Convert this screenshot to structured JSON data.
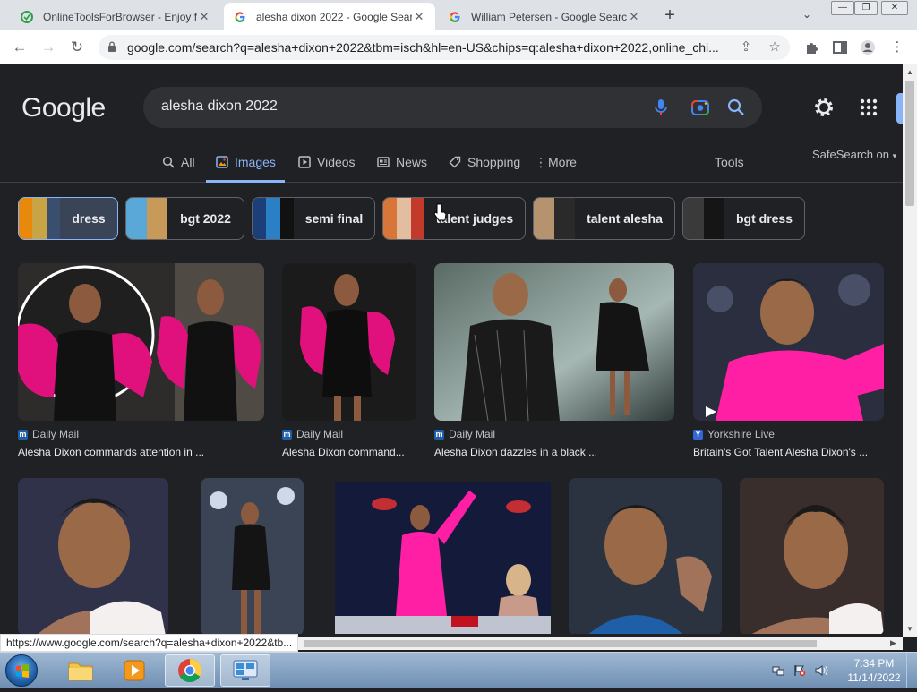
{
  "browser": {
    "tabs": [
      {
        "title": "OnlineToolsForBrowser - Enjoy fr",
        "active": false
      },
      {
        "title": "alesha dixon 2022 - Google Sear",
        "active": true
      },
      {
        "title": "William Petersen - Google Search",
        "active": false
      }
    ],
    "new_tab": "+",
    "url": "google.com/search?q=alesha+dixon+2022&tbm=isch&hl=en-US&chips=q:alesha+dixon+2022,online_chi...",
    "status_url": "https://www.google.com/search?q=alesha+dixon+2022&tb..."
  },
  "google": {
    "logo": "Google",
    "query": "alesha dixon 2022",
    "nav_tabs": [
      {
        "label": "All",
        "icon": "search-icon",
        "active": false
      },
      {
        "label": "Images",
        "icon": "image-icon",
        "active": true
      },
      {
        "label": "Videos",
        "icon": "play-icon",
        "active": false
      },
      {
        "label": "News",
        "icon": "news-icon",
        "active": false
      },
      {
        "label": "Shopping",
        "icon": "tag-icon",
        "active": false
      },
      {
        "label": "More",
        "icon": "more-vert-icon",
        "active": false
      }
    ],
    "tools": "Tools",
    "safesearch": "SafeSearch on",
    "chips": [
      {
        "label": "dress",
        "selected": true
      },
      {
        "label": "bgt 2022",
        "selected": false
      },
      {
        "label": "semi final",
        "selected": false
      },
      {
        "label": "talent judges",
        "selected": false
      },
      {
        "label": "talent alesha",
        "selected": false
      },
      {
        "label": "bgt dress",
        "selected": false
      }
    ],
    "results_row1": [
      {
        "source": "Daily Mail",
        "caption": "Alesha Dixon commands attention in ..."
      },
      {
        "source": "Daily Mail",
        "caption": "Alesha Dixon command..."
      },
      {
        "source": "Daily Mail",
        "caption": "Alesha Dixon dazzles in a black ..."
      },
      {
        "source": "Yorkshire Live",
        "caption": "Britain's Got Talent Alesha Dixon's ..."
      }
    ]
  },
  "taskbar": {
    "time": "7:34 PM",
    "date": "11/14/2022"
  },
  "colors": {
    "accent": "#8ab4f8",
    "page_bg": "#202124",
    "search_bg": "#303134",
    "pink": "#e0117d"
  }
}
